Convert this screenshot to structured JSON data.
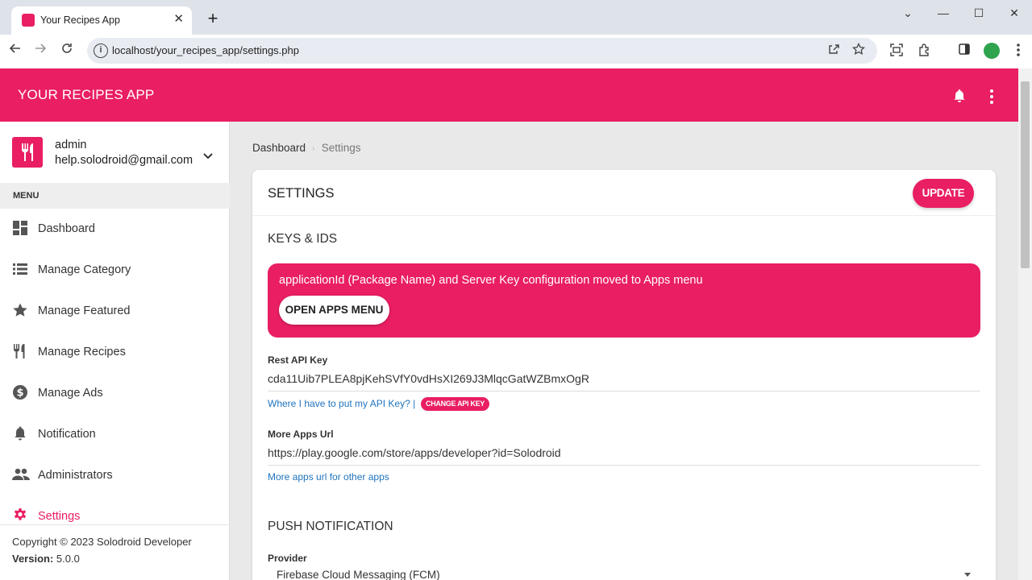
{
  "browser": {
    "tab_title": "Your Recipes App",
    "tab_close": "✕",
    "new_tab": "+",
    "url": "localhost/your_recipes_app/settings.php",
    "window_controls": [
      "⌄",
      "—",
      "☐",
      "✕"
    ]
  },
  "app": {
    "title": "YOUR RECIPES APP",
    "accent_color": "#e91e63"
  },
  "user": {
    "name": "admin",
    "email": "help.solodroid@gmail.com"
  },
  "sidebar": {
    "menu_header": "MENU",
    "items": [
      {
        "label": "Dashboard",
        "icon": "dashboard-icon"
      },
      {
        "label": "Manage Category",
        "icon": "list-icon"
      },
      {
        "label": "Manage Featured",
        "icon": "star-icon"
      },
      {
        "label": "Manage Recipes",
        "icon": "restaurant-icon"
      },
      {
        "label": "Manage Ads",
        "icon": "dollar-icon"
      },
      {
        "label": "Notification",
        "icon": "bell-icon"
      },
      {
        "label": "Administrators",
        "icon": "people-icon"
      },
      {
        "label": "Settings",
        "icon": "gear-icon",
        "active": true
      }
    ],
    "copyright": "Copyright © 2023 Solodroid Developer",
    "version_label": "Version:",
    "version": "5.0.0"
  },
  "breadcrumb": {
    "home": "Dashboard",
    "separator": "›",
    "current": "Settings"
  },
  "settings": {
    "title": "SETTINGS",
    "update_label": "UPDATE",
    "keys_title": "KEYS & IDS",
    "alert_text": "applicationId (Package Name) and Server Key configuration moved to Apps menu",
    "open_apps_label": "OPEN APPS MENU",
    "rest_api_label": "Rest API Key",
    "rest_api_value": "cda11Uib7PLEA8pjKehSVfY0vdHsXI269J3MlqcGatWZBmxOgR",
    "api_help": "Where I have to put my API Key? |",
    "change_api_label": "CHANGE API KEY",
    "more_apps_label": "More Apps Url",
    "more_apps_value": "https://play.google.com/store/apps/developer?id=Solodroid",
    "more_apps_help": "More apps url for other apps",
    "push_title": "PUSH NOTIFICATION",
    "provider_label": "Provider",
    "provider_value": "Firebase Cloud Messaging (FCM)"
  }
}
